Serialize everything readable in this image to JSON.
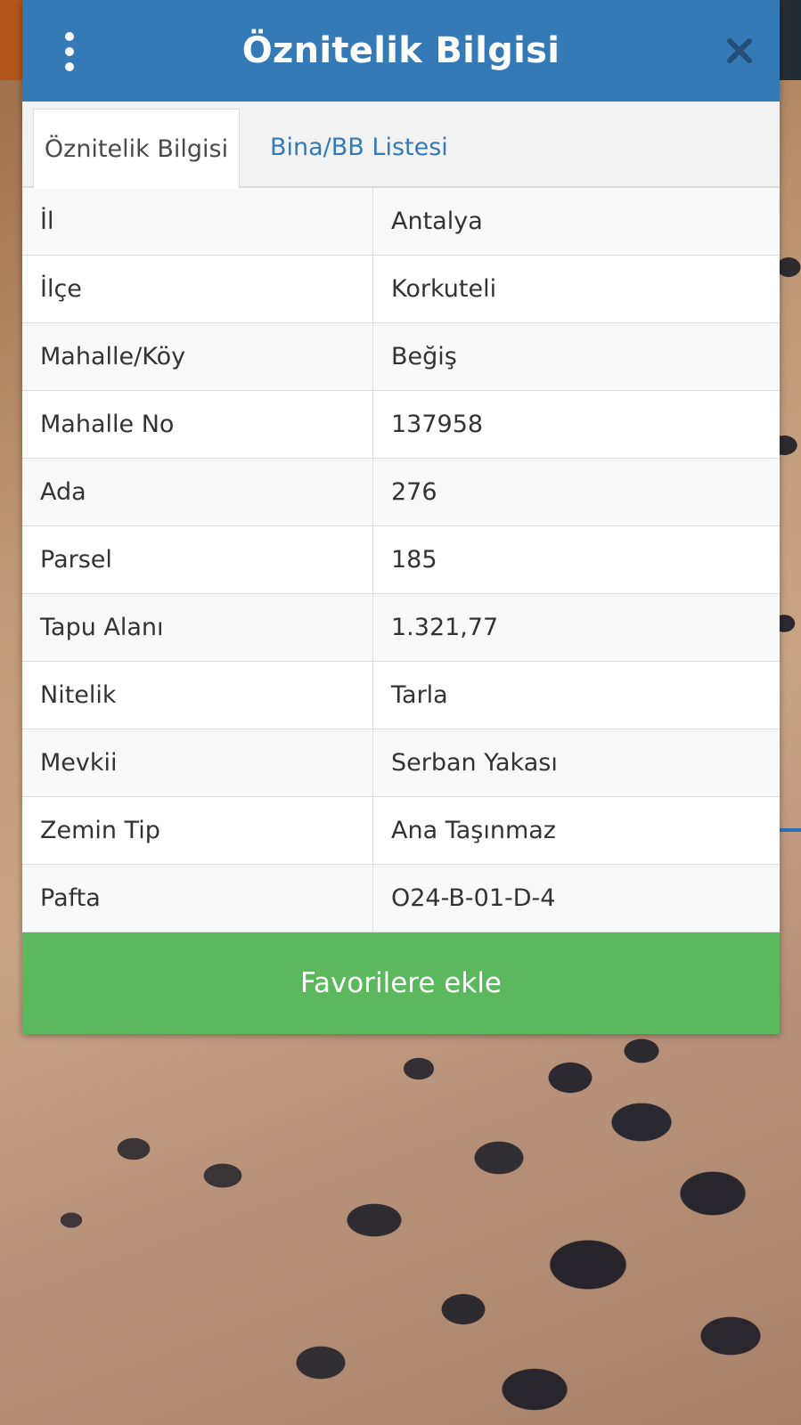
{
  "header": {
    "title": "Öznitelik Bilgisi",
    "menu_icon": "vertical-ellipsis-icon",
    "close_icon": "close-icon"
  },
  "tabs": [
    {
      "label": "Öznitelik Bilgisi",
      "active": true
    },
    {
      "label": "Bina/BB Listesi",
      "active": false
    }
  ],
  "attributes": [
    {
      "key": "İl",
      "value": "Antalya"
    },
    {
      "key": "İlçe",
      "value": "Korkuteli"
    },
    {
      "key": "Mahalle/Köy",
      "value": "Beğiş"
    },
    {
      "key": "Mahalle No",
      "value": "137958"
    },
    {
      "key": "Ada",
      "value": "276"
    },
    {
      "key": "Parsel",
      "value": "185"
    },
    {
      "key": "Tapu Alanı",
      "value": "1.321,77"
    },
    {
      "key": "Nitelik",
      "value": "Tarla"
    },
    {
      "key": "Mevkii",
      "value": "Serban Yakası"
    },
    {
      "key": "Zemin Tip",
      "value": "Ana Taşınmaz"
    },
    {
      "key": "Pafta",
      "value": "O24-B-01-D-4"
    }
  ],
  "actions": {
    "favorite_label": "Favorilere ekle"
  },
  "colors": {
    "header": "#337ab7",
    "favorite_button": "#5cb85c",
    "tab_link": "#337ab7"
  }
}
